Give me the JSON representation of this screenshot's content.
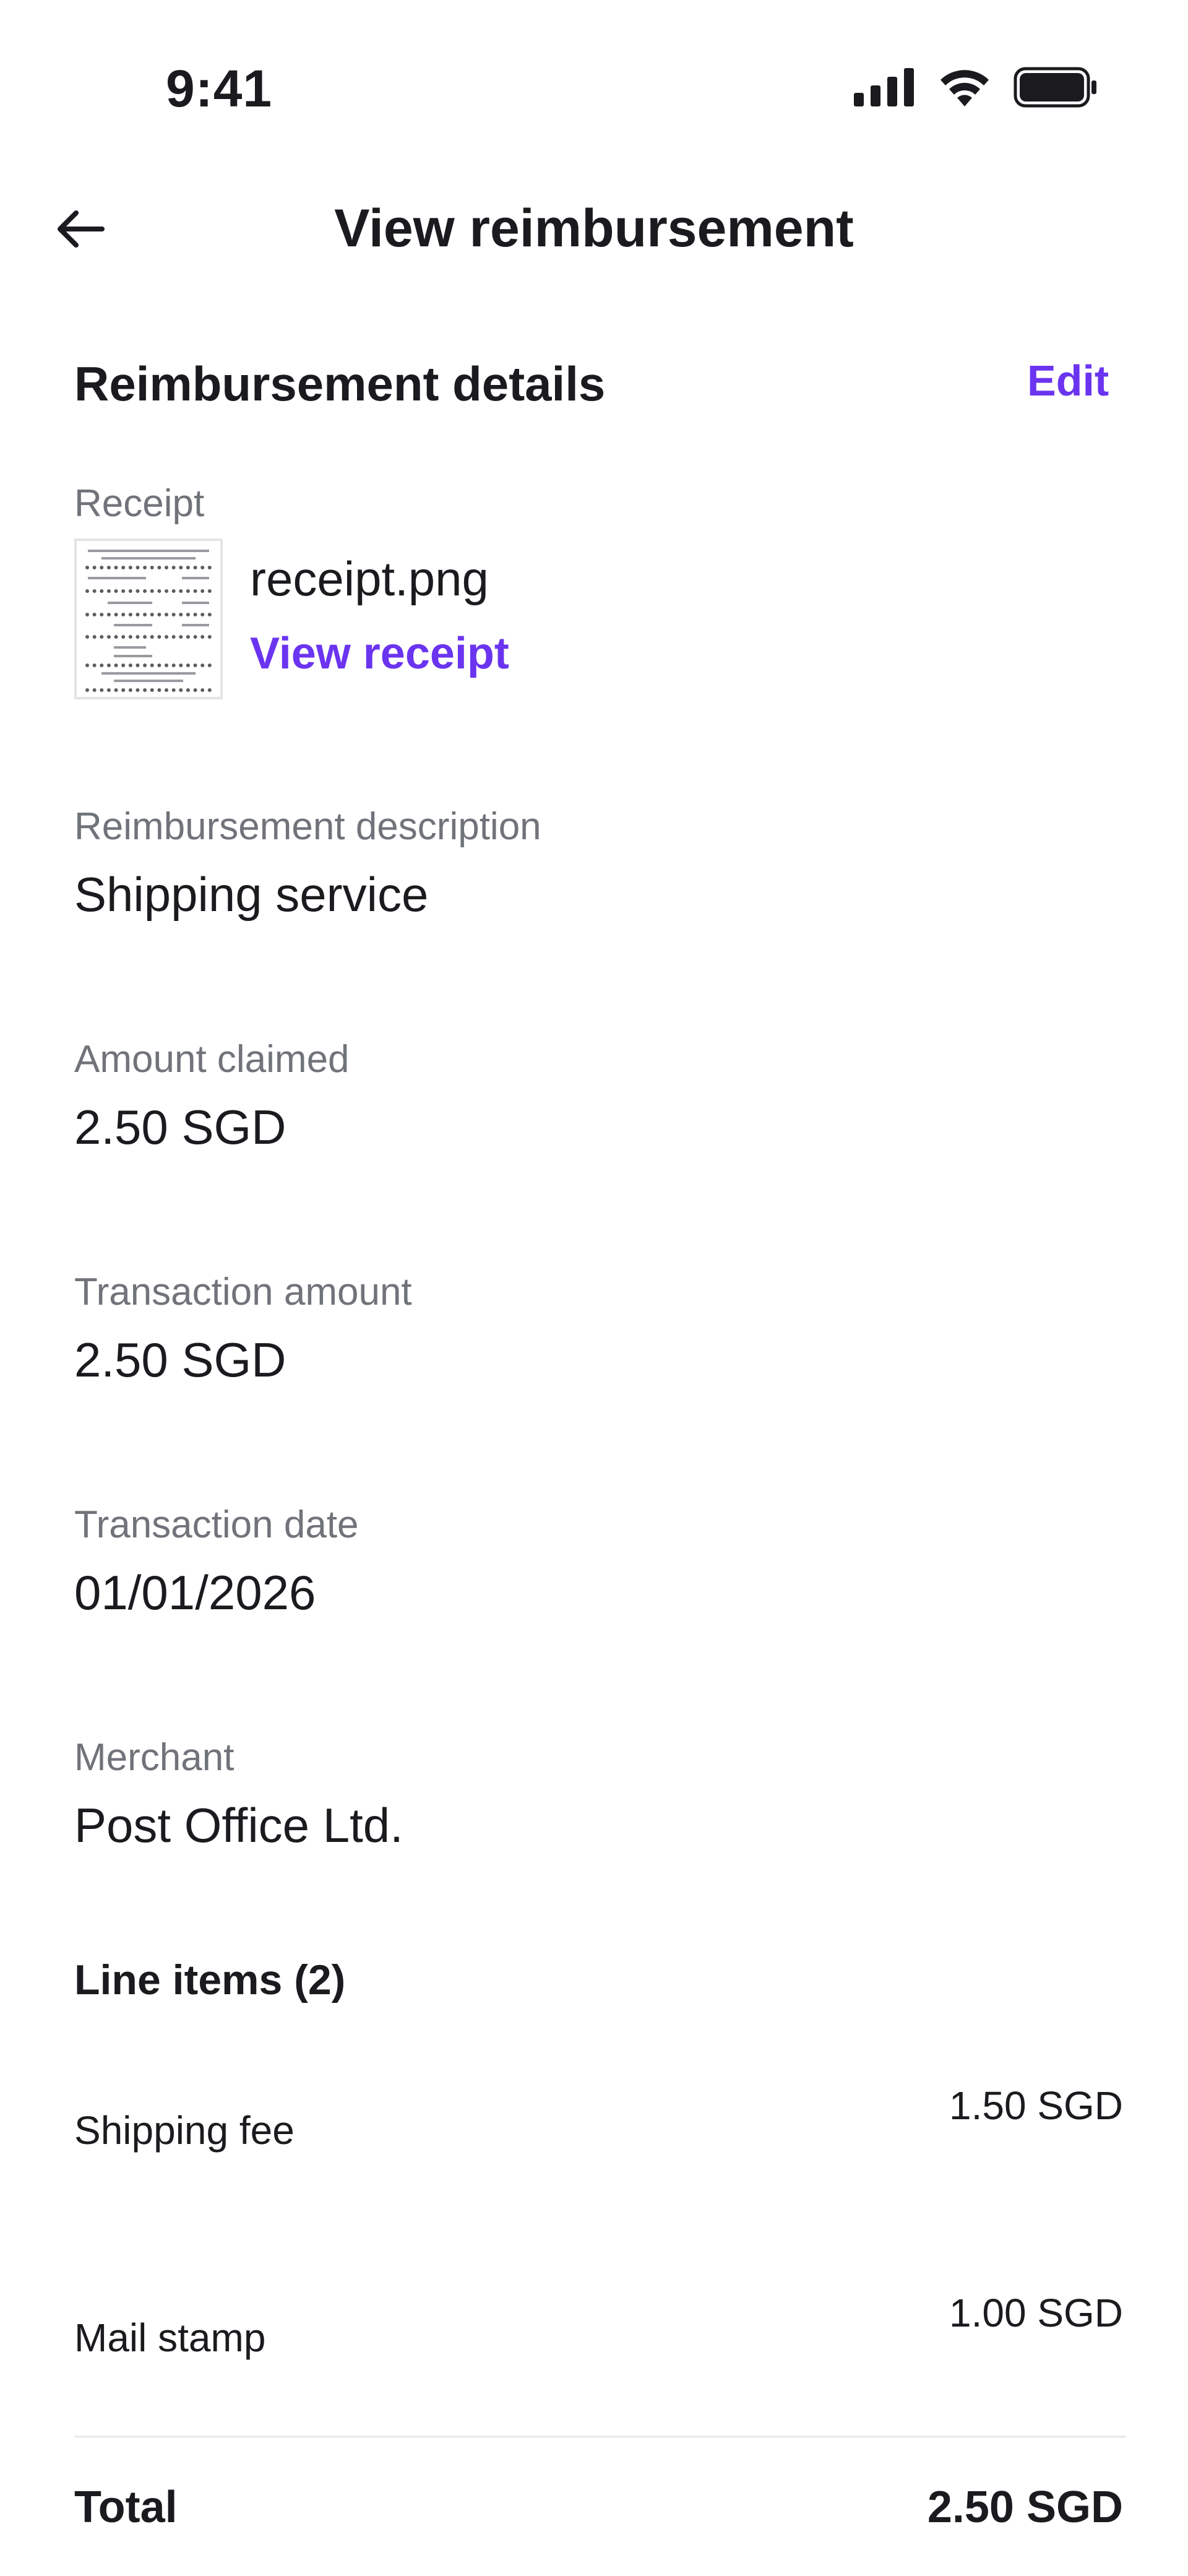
{
  "status_bar": {
    "time": "9:41"
  },
  "nav": {
    "title": "View reimbursement"
  },
  "section": {
    "title": "Reimbursement details",
    "edit_label": "Edit"
  },
  "receipt": {
    "label": "Receipt",
    "filename": "receipt.png",
    "view_label": "View receipt"
  },
  "fields": {
    "description": {
      "label": "Reimbursement description",
      "value": "Shipping service"
    },
    "amount_claimed": {
      "label": "Amount claimed",
      "value": "2.50 SGD"
    },
    "transaction_amount": {
      "label": "Transaction amount",
      "value": "2.50 SGD"
    },
    "transaction_date": {
      "label": "Transaction date",
      "value": "01/01/2026"
    },
    "merchant": {
      "label": "Merchant",
      "value": "Post Office Ltd."
    }
  },
  "line_items": {
    "title": "Line items (2)",
    "items": [
      {
        "name": "Shipping fee",
        "amount": "1.50 SGD"
      },
      {
        "name": "Mail stamp",
        "amount": "1.00 SGD"
      }
    ],
    "total_label": "Total",
    "total_amount": "2.50 SGD"
  },
  "colors": {
    "accent": "#6b34f0",
    "label_gray": "#70737a",
    "text": "#1b1b1f"
  }
}
